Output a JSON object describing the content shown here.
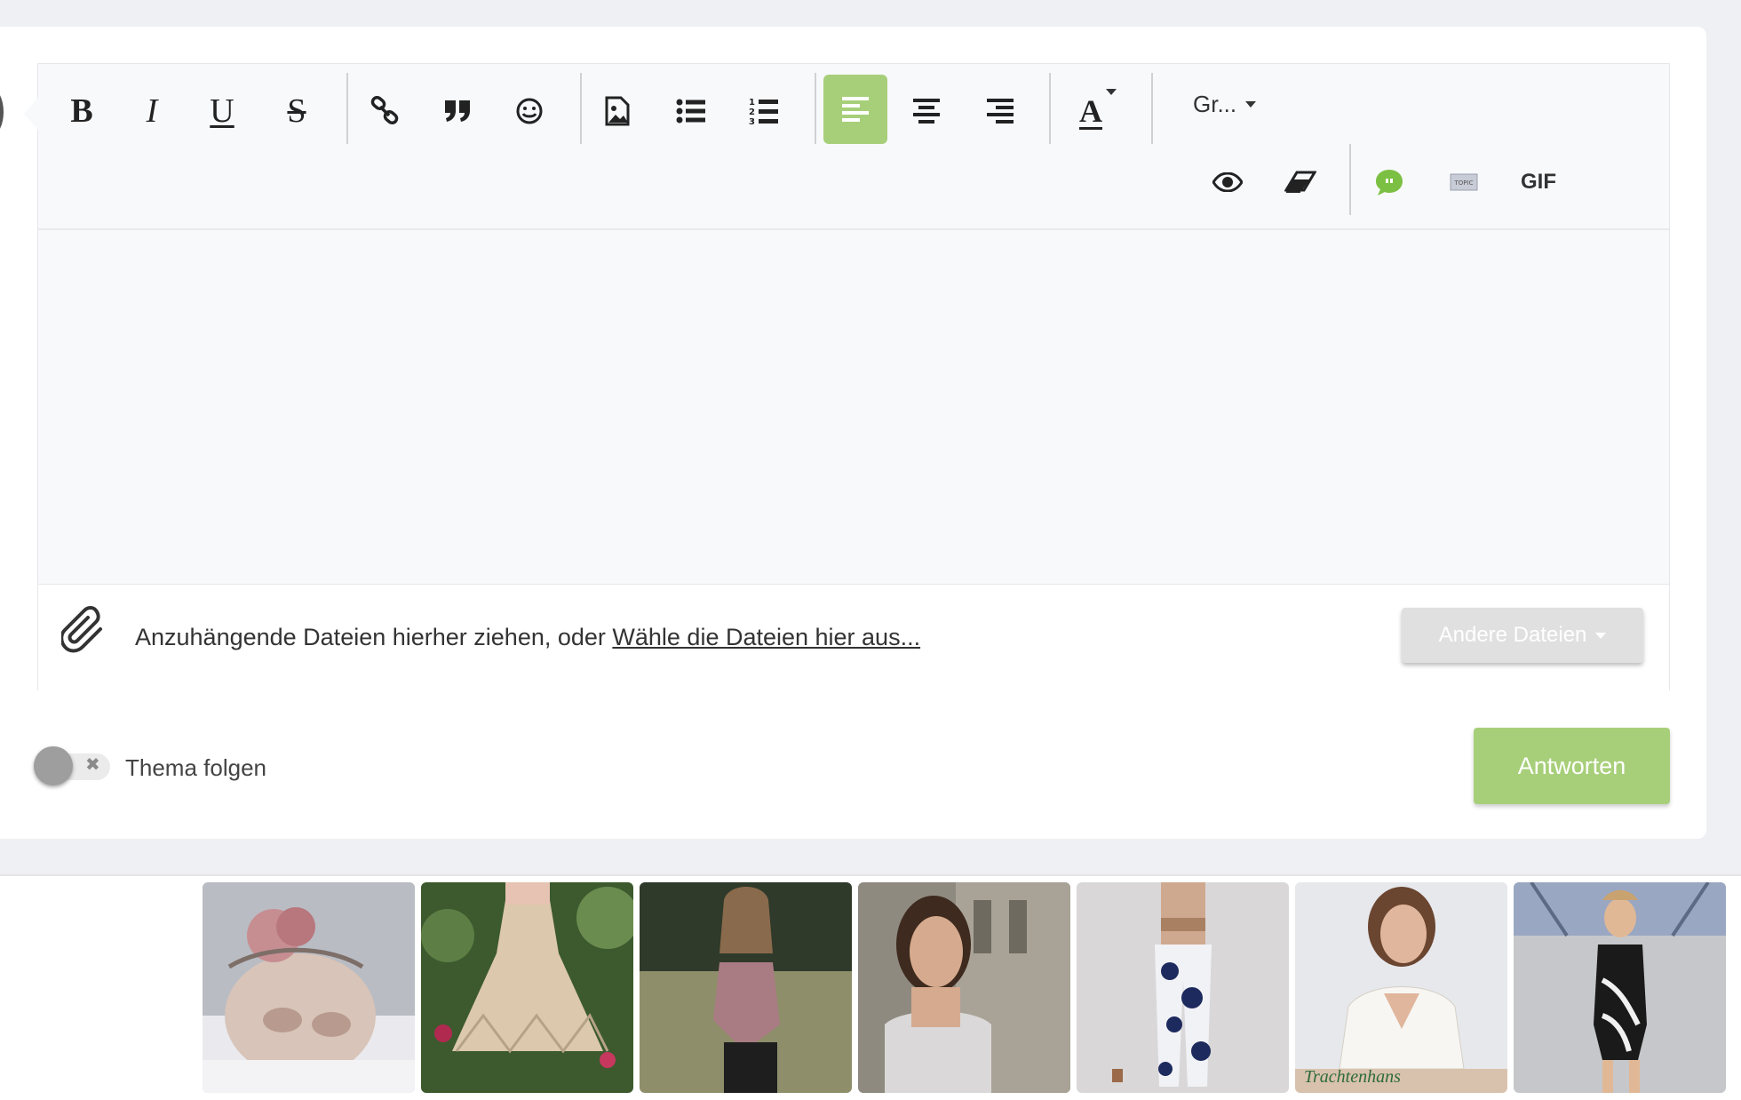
{
  "toolbar": {
    "bold": "B",
    "italic": "I",
    "underline": "U",
    "strike": "S",
    "font_color": "A",
    "size_dropdown": "Gr...",
    "gif": "GIF"
  },
  "attachments": {
    "prompt": "Anzuhängende Dateien hierher ziehen, oder ",
    "link": "Wähle die Dateien hier aus...",
    "other_files_button": "Andere Dateien"
  },
  "follow": {
    "label": "Thema folgen",
    "toggle_symbol": "✖",
    "enabled": false
  },
  "reply_button": "Antworten",
  "colors": {
    "accent": "#a7cf79",
    "background": "#eef0f4"
  },
  "icons": [
    "bold-icon",
    "italic-icon",
    "underline-icon",
    "strikethrough-icon",
    "link-icon",
    "quote-icon",
    "emoji-icon",
    "image-icon",
    "bullet-list-icon",
    "numbered-list-icon",
    "align-left-icon",
    "align-center-icon",
    "align-right-icon",
    "font-color-icon",
    "preview-eye-icon",
    "eraser-icon",
    "chat-bubble-icon",
    "topic-icon",
    "paperclip-icon"
  ],
  "gallery": [
    {
      "name": "thumb-baby"
    },
    {
      "name": "thumb-crochet-dress"
    },
    {
      "name": "thumb-woman-field"
    },
    {
      "name": "thumb-woman-portrait"
    },
    {
      "name": "thumb-patterned-pants"
    },
    {
      "name": "thumb-lace-blouse",
      "watermark": "Trachtenhans"
    },
    {
      "name": "thumb-dancer"
    }
  ]
}
